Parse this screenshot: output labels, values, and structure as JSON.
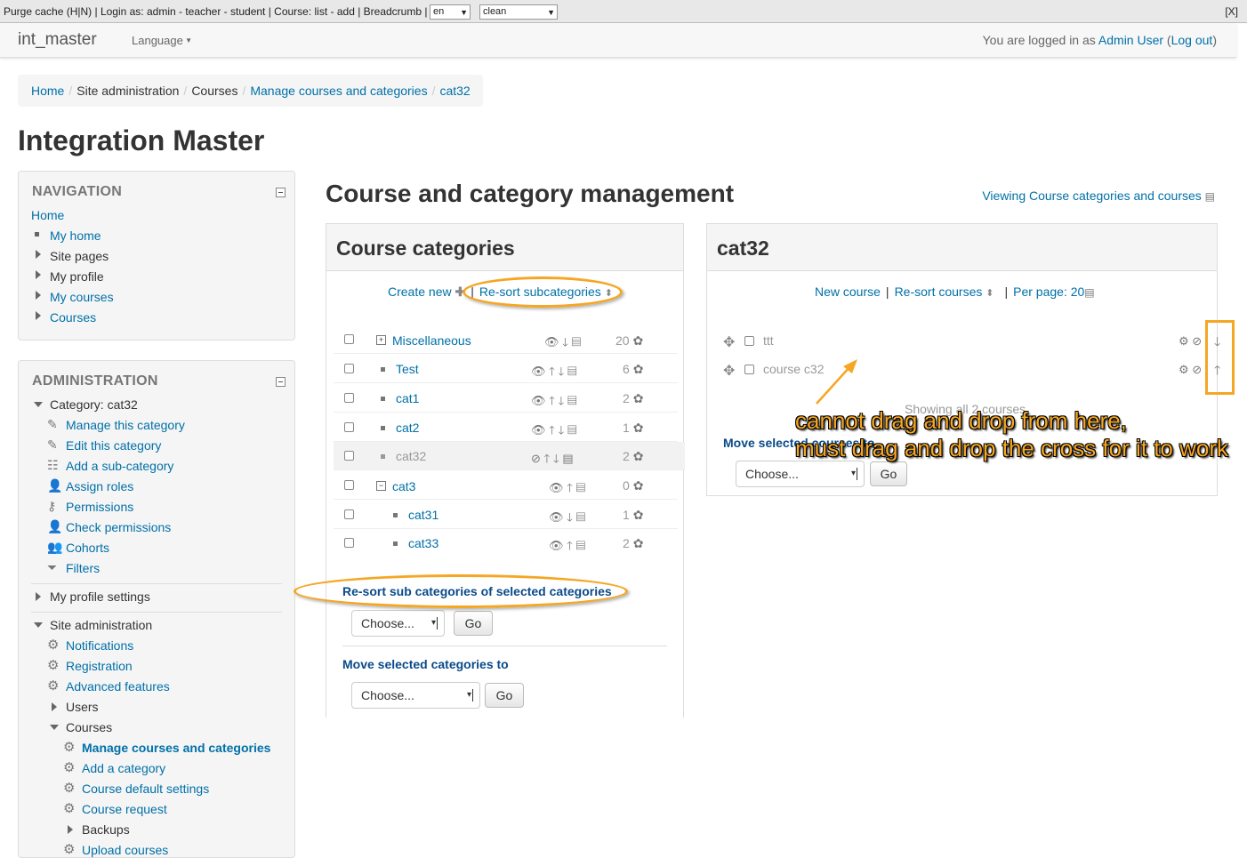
{
  "devbar": {
    "text": "Purge cache (H|N) | Login as: admin - teacher - student | Course: list - add | Breadcrumb |",
    "lang_select": "en",
    "theme_select": "clean",
    "close": "[X]"
  },
  "navbar": {
    "brand": "int_master",
    "language": "Language",
    "logged_prefix": "You are logged in as",
    "user": "Admin User",
    "logout": "Log out"
  },
  "breadcrumb": [
    "Home",
    "Site administration",
    "Courses",
    "Manage courses and categories",
    "cat32"
  ],
  "site_title": "Integration Master",
  "navigation": {
    "title": "NAVIGATION",
    "items": [
      "Home",
      "My home",
      "Site pages",
      "My profile",
      "My courses",
      "Courses"
    ]
  },
  "administration": {
    "title": "ADMINISTRATION",
    "category": "Category: cat32",
    "category_items": [
      "Manage this category",
      "Edit this category",
      "Add a sub-category",
      "Assign roles",
      "Permissions",
      "Check permissions",
      "Cohorts",
      "Filters"
    ],
    "profile_settings": "My profile settings",
    "site_admin": "Site administration",
    "site_items": [
      "Notifications",
      "Registration",
      "Advanced features",
      "Users",
      "Courses"
    ],
    "courses_items": [
      "Manage courses and categories",
      "Add a category",
      "Course default settings",
      "Course request",
      "Backups",
      "Upload courses"
    ]
  },
  "main": {
    "title": "Course and category management",
    "viewing": "Viewing Course categories and courses"
  },
  "categories_panel": {
    "title": "Course categories",
    "create_new": "Create new",
    "resort": "Re-sort subcategories",
    "rows": [
      {
        "name": "Miscellaneous",
        "count": "20"
      },
      {
        "name": "Test",
        "count": "6"
      },
      {
        "name": "cat1",
        "count": "2"
      },
      {
        "name": "cat2",
        "count": "1"
      },
      {
        "name": "cat32",
        "count": "2"
      },
      {
        "name": "cat3",
        "count": "0"
      },
      {
        "name": "cat31",
        "count": "1"
      },
      {
        "name": "cat33",
        "count": "2"
      }
    ],
    "resort_selected_label": "Re-sort sub categories of selected categories",
    "move_label": "Move selected categories to",
    "choose": "Choose...",
    "go": "Go"
  },
  "courses_panel": {
    "title": "cat32",
    "new_course": "New course",
    "resort_courses": "Re-sort courses",
    "per_page": "Per page: 20",
    "courses": [
      "ttt",
      "course c32"
    ],
    "showing": "Showing all 2 courses",
    "move_label": "Move selected courses to",
    "choose": "Choose...",
    "go": "Go"
  },
  "annotation": {
    "line1": "cannot drag and drop from here,",
    "line2": "must drag and drop the cross for it to work"
  },
  "colors": {
    "link": "#0070a8",
    "annotation": "#f5a623",
    "bold_label": "#0a4a8a"
  }
}
